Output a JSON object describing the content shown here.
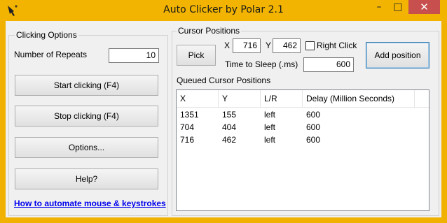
{
  "window": {
    "title": "Auto Clicker by Polar 2.1",
    "minimize_glyph": "–",
    "maximize_glyph": "□",
    "close_glyph": "✕",
    "frame_color": "#f0b100"
  },
  "clicking_options": {
    "title": "Clicking Options",
    "repeats_label": "Number of Repeats",
    "repeats_value": "10",
    "start_label": "Start clicking (F4)",
    "stop_label": "Stop clicking (F4)",
    "options_label": "Options...",
    "help_label": "Help?",
    "link_label": "How to automate mouse & keystrokes"
  },
  "cursor_positions": {
    "title": "Cursor Positions",
    "pick_label": "Pick",
    "x_label": "X",
    "x_value": "716",
    "y_label": "Y",
    "y_value": "462",
    "right_click_label": "Right Click",
    "right_click_checked": false,
    "sleep_label": "Time to Sleep (.ms)",
    "sleep_value": "600",
    "add_label": "Add position",
    "queued_label": "Queued Cursor Positions"
  },
  "queue": {
    "columns": [
      "X",
      "Y",
      "L/R",
      "Delay (Million Seconds)"
    ],
    "rows": [
      [
        "1351",
        "155",
        "left",
        "600"
      ],
      [
        "704",
        "404",
        "left",
        "600"
      ],
      [
        "716",
        "462",
        "left",
        "600"
      ]
    ]
  }
}
